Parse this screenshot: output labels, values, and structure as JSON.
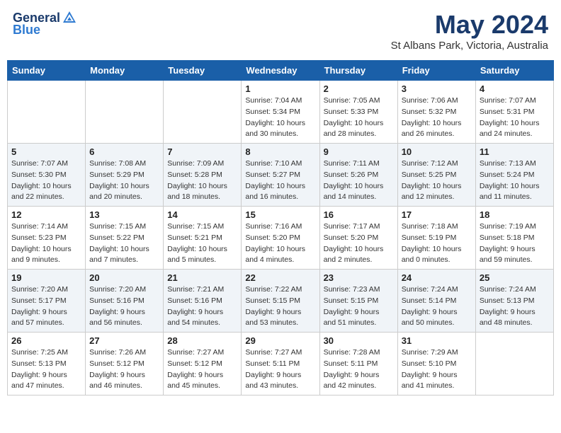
{
  "header": {
    "logo_general": "General",
    "logo_blue": "Blue",
    "month": "May 2024",
    "location": "St Albans Park, Victoria, Australia"
  },
  "weekdays": [
    "Sunday",
    "Monday",
    "Tuesday",
    "Wednesday",
    "Thursday",
    "Friday",
    "Saturday"
  ],
  "weeks": [
    [
      {
        "day": "",
        "sunrise": "",
        "sunset": "",
        "daylight": ""
      },
      {
        "day": "",
        "sunrise": "",
        "sunset": "",
        "daylight": ""
      },
      {
        "day": "",
        "sunrise": "",
        "sunset": "",
        "daylight": ""
      },
      {
        "day": "1",
        "sunrise": "Sunrise: 7:04 AM",
        "sunset": "Sunset: 5:34 PM",
        "daylight": "Daylight: 10 hours and 30 minutes."
      },
      {
        "day": "2",
        "sunrise": "Sunrise: 7:05 AM",
        "sunset": "Sunset: 5:33 PM",
        "daylight": "Daylight: 10 hours and 28 minutes."
      },
      {
        "day": "3",
        "sunrise": "Sunrise: 7:06 AM",
        "sunset": "Sunset: 5:32 PM",
        "daylight": "Daylight: 10 hours and 26 minutes."
      },
      {
        "day": "4",
        "sunrise": "Sunrise: 7:07 AM",
        "sunset": "Sunset: 5:31 PM",
        "daylight": "Daylight: 10 hours and 24 minutes."
      }
    ],
    [
      {
        "day": "5",
        "sunrise": "Sunrise: 7:07 AM",
        "sunset": "Sunset: 5:30 PM",
        "daylight": "Daylight: 10 hours and 22 minutes."
      },
      {
        "day": "6",
        "sunrise": "Sunrise: 7:08 AM",
        "sunset": "Sunset: 5:29 PM",
        "daylight": "Daylight: 10 hours and 20 minutes."
      },
      {
        "day": "7",
        "sunrise": "Sunrise: 7:09 AM",
        "sunset": "Sunset: 5:28 PM",
        "daylight": "Daylight: 10 hours and 18 minutes."
      },
      {
        "day": "8",
        "sunrise": "Sunrise: 7:10 AM",
        "sunset": "Sunset: 5:27 PM",
        "daylight": "Daylight: 10 hours and 16 minutes."
      },
      {
        "day": "9",
        "sunrise": "Sunrise: 7:11 AM",
        "sunset": "Sunset: 5:26 PM",
        "daylight": "Daylight: 10 hours and 14 minutes."
      },
      {
        "day": "10",
        "sunrise": "Sunrise: 7:12 AM",
        "sunset": "Sunset: 5:25 PM",
        "daylight": "Daylight: 10 hours and 12 minutes."
      },
      {
        "day": "11",
        "sunrise": "Sunrise: 7:13 AM",
        "sunset": "Sunset: 5:24 PM",
        "daylight": "Daylight: 10 hours and 11 minutes."
      }
    ],
    [
      {
        "day": "12",
        "sunrise": "Sunrise: 7:14 AM",
        "sunset": "Sunset: 5:23 PM",
        "daylight": "Daylight: 10 hours and 9 minutes."
      },
      {
        "day": "13",
        "sunrise": "Sunrise: 7:15 AM",
        "sunset": "Sunset: 5:22 PM",
        "daylight": "Daylight: 10 hours and 7 minutes."
      },
      {
        "day": "14",
        "sunrise": "Sunrise: 7:15 AM",
        "sunset": "Sunset: 5:21 PM",
        "daylight": "Daylight: 10 hours and 5 minutes."
      },
      {
        "day": "15",
        "sunrise": "Sunrise: 7:16 AM",
        "sunset": "Sunset: 5:20 PM",
        "daylight": "Daylight: 10 hours and 4 minutes."
      },
      {
        "day": "16",
        "sunrise": "Sunrise: 7:17 AM",
        "sunset": "Sunset: 5:20 PM",
        "daylight": "Daylight: 10 hours and 2 minutes."
      },
      {
        "day": "17",
        "sunrise": "Sunrise: 7:18 AM",
        "sunset": "Sunset: 5:19 PM",
        "daylight": "Daylight: 10 hours and 0 minutes."
      },
      {
        "day": "18",
        "sunrise": "Sunrise: 7:19 AM",
        "sunset": "Sunset: 5:18 PM",
        "daylight": "Daylight: 9 hours and 59 minutes."
      }
    ],
    [
      {
        "day": "19",
        "sunrise": "Sunrise: 7:20 AM",
        "sunset": "Sunset: 5:17 PM",
        "daylight": "Daylight: 9 hours and 57 minutes."
      },
      {
        "day": "20",
        "sunrise": "Sunrise: 7:20 AM",
        "sunset": "Sunset: 5:16 PM",
        "daylight": "Daylight: 9 hours and 56 minutes."
      },
      {
        "day": "21",
        "sunrise": "Sunrise: 7:21 AM",
        "sunset": "Sunset: 5:16 PM",
        "daylight": "Daylight: 9 hours and 54 minutes."
      },
      {
        "day": "22",
        "sunrise": "Sunrise: 7:22 AM",
        "sunset": "Sunset: 5:15 PM",
        "daylight": "Daylight: 9 hours and 53 minutes."
      },
      {
        "day": "23",
        "sunrise": "Sunrise: 7:23 AM",
        "sunset": "Sunset: 5:15 PM",
        "daylight": "Daylight: 9 hours and 51 minutes."
      },
      {
        "day": "24",
        "sunrise": "Sunrise: 7:24 AM",
        "sunset": "Sunset: 5:14 PM",
        "daylight": "Daylight: 9 hours and 50 minutes."
      },
      {
        "day": "25",
        "sunrise": "Sunrise: 7:24 AM",
        "sunset": "Sunset: 5:13 PM",
        "daylight": "Daylight: 9 hours and 48 minutes."
      }
    ],
    [
      {
        "day": "26",
        "sunrise": "Sunrise: 7:25 AM",
        "sunset": "Sunset: 5:13 PM",
        "daylight": "Daylight: 9 hours and 47 minutes."
      },
      {
        "day": "27",
        "sunrise": "Sunrise: 7:26 AM",
        "sunset": "Sunset: 5:12 PM",
        "daylight": "Daylight: 9 hours and 46 minutes."
      },
      {
        "day": "28",
        "sunrise": "Sunrise: 7:27 AM",
        "sunset": "Sunset: 5:12 PM",
        "daylight": "Daylight: 9 hours and 45 minutes."
      },
      {
        "day": "29",
        "sunrise": "Sunrise: 7:27 AM",
        "sunset": "Sunset: 5:11 PM",
        "daylight": "Daylight: 9 hours and 43 minutes."
      },
      {
        "day": "30",
        "sunrise": "Sunrise: 7:28 AM",
        "sunset": "Sunset: 5:11 PM",
        "daylight": "Daylight: 9 hours and 42 minutes."
      },
      {
        "day": "31",
        "sunrise": "Sunrise: 7:29 AM",
        "sunset": "Sunset: 5:10 PM",
        "daylight": "Daylight: 9 hours and 41 minutes."
      },
      {
        "day": "",
        "sunrise": "",
        "sunset": "",
        "daylight": ""
      }
    ]
  ]
}
